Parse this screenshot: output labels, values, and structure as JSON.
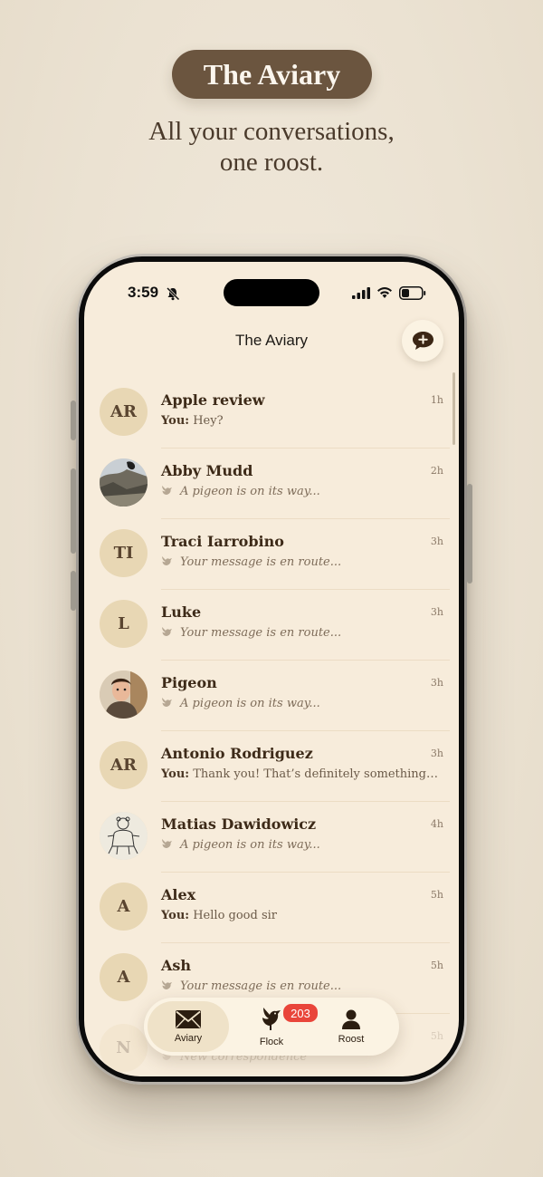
{
  "hero": {
    "brand": "The Aviary",
    "tagline_line1": "All your conversations,",
    "tagline_line2": "one roost."
  },
  "status_bar": {
    "time": "3:59"
  },
  "header": {
    "title": "The Aviary"
  },
  "conversations": [
    {
      "initials": "AR",
      "name": "Apple review",
      "time": "1h",
      "prefix": "You:",
      "preview": "Hey?",
      "italic": false,
      "avatar": "initials"
    },
    {
      "initials": "",
      "name": "Abby Mudd",
      "time": "2h",
      "prefix": "",
      "preview": "A pigeon is on its way...",
      "italic": true,
      "avatar": "photo-landscape"
    },
    {
      "initials": "TI",
      "name": "Traci Iarrobino",
      "time": "3h",
      "prefix": "",
      "preview": "Your message is en route...",
      "italic": true,
      "avatar": "initials"
    },
    {
      "initials": "L",
      "name": "Luke",
      "time": "3h",
      "prefix": "",
      "preview": "Your message is en route...",
      "italic": true,
      "avatar": "initials"
    },
    {
      "initials": "",
      "name": "Pigeon",
      "time": "3h",
      "prefix": "",
      "preview": "A pigeon is on its way...",
      "italic": true,
      "avatar": "photo-person"
    },
    {
      "initials": "AR",
      "name": "Antonio Rodriguez",
      "time": "3h",
      "prefix": "You:",
      "preview": "Thank you! That’s definitely something I c...",
      "italic": false,
      "avatar": "initials"
    },
    {
      "initials": "",
      "name": "Matias Dawidowicz",
      "time": "4h",
      "prefix": "",
      "preview": "A pigeon is on its way...",
      "italic": true,
      "avatar": "sketch-bears"
    },
    {
      "initials": "A",
      "name": "Alex",
      "time": "5h",
      "prefix": "You:",
      "preview": "Hello good sir",
      "italic": false,
      "avatar": "initials"
    },
    {
      "initials": "A",
      "name": "Ash",
      "time": "5h",
      "prefix": "",
      "preview": "Your message is en route...",
      "italic": true,
      "avatar": "initials"
    },
    {
      "initials": "N",
      "name": "",
      "time": "5h",
      "prefix": "",
      "preview": "New correspondence",
      "italic": true,
      "avatar": "initials"
    }
  ],
  "tabbar": {
    "tabs": [
      {
        "label": "Aviary",
        "icon": "envelope-icon",
        "active": true
      },
      {
        "label": "Flock",
        "icon": "bird-icon",
        "active": false
      },
      {
        "label": "Roost",
        "icon": "person-icon",
        "active": false
      }
    ],
    "flock_badge": "203"
  },
  "colors": {
    "background": "#ebe2d2",
    "brand_pill": "#6b553f",
    "screen": "#f7ecdb",
    "avatar_fill": "#e8d7b4",
    "badge": "#e9453a",
    "text_dark": "#3d2a18"
  }
}
